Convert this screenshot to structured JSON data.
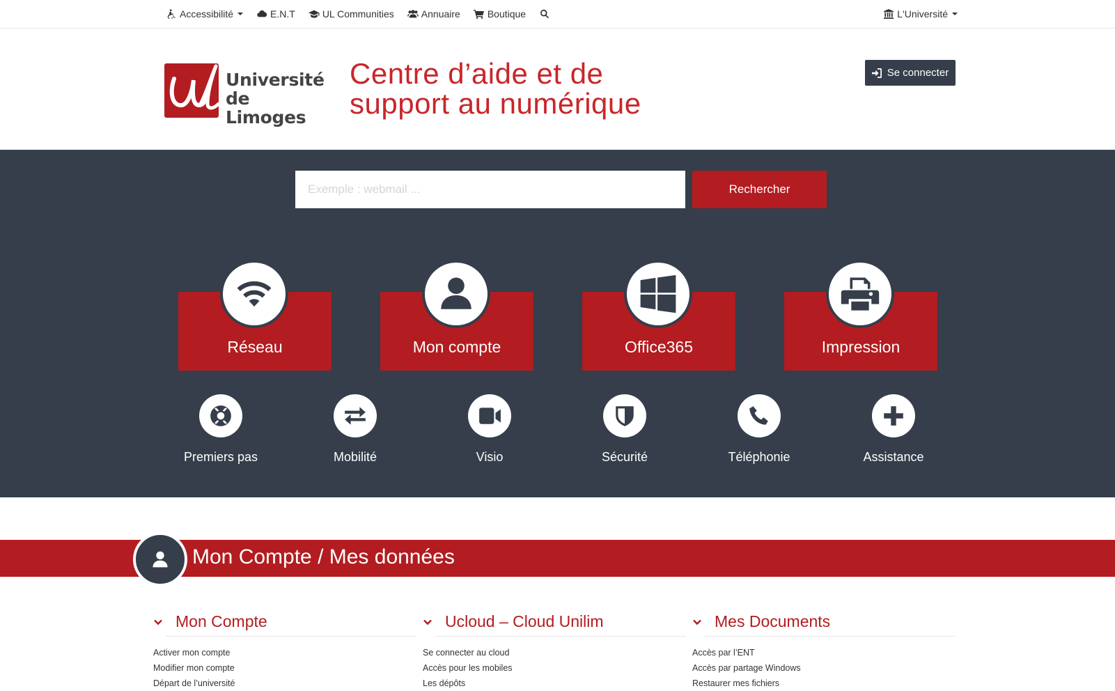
{
  "topbar": {
    "left": [
      {
        "label": "Accessibilité",
        "icon": "wheelchair-icon",
        "caret": true
      },
      {
        "label": "E.N.T",
        "icon": "cloud-icon",
        "caret": false
      },
      {
        "label": "UL Communities",
        "icon": "graduation-cap-icon",
        "caret": false
      },
      {
        "label": "Annuaire",
        "icon": "users-icon",
        "caret": false
      },
      {
        "label": "Boutique",
        "icon": "cart-icon",
        "caret": false
      }
    ],
    "right": {
      "label": "L'Université",
      "icon": "university-icon"
    }
  },
  "header": {
    "logo_line1": "Université",
    "logo_line2": "de Limoges",
    "title_line1": "Centre d’aide et de",
    "title_line2": "support au numérique",
    "login_label": "Se connecter"
  },
  "search": {
    "placeholder": "Exemple : webmail ...",
    "button_label": "Rechercher"
  },
  "big_tiles": [
    {
      "label": "Réseau",
      "icon": "wifi-icon"
    },
    {
      "label": "Mon compte",
      "icon": "user-icon"
    },
    {
      "label": "Office365",
      "icon": "windows-icon"
    },
    {
      "label": "Impression",
      "icon": "printer-icon"
    }
  ],
  "small_tiles": [
    {
      "label": "Premiers pas",
      "icon": "lifebuoy-icon"
    },
    {
      "label": "Mobilité",
      "icon": "exchange-icon"
    },
    {
      "label": "Visio",
      "icon": "video-camera-icon"
    },
    {
      "label": "Sécurité",
      "icon": "shield-icon"
    },
    {
      "label": "Téléphonie",
      "icon": "phone-icon"
    },
    {
      "label": "Assistance",
      "icon": "plus-icon"
    }
  ],
  "section": {
    "title": "Mon Compte / Mes données",
    "icon": "user-icon"
  },
  "columns": [
    {
      "title": "Mon Compte",
      "links": [
        "Activer mon compte",
        "Modifier mon compte",
        "Départ de l’université"
      ]
    },
    {
      "title": "Ucloud – Cloud Unilim",
      "links": [
        "Se connecter au cloud",
        "Accès pour les mobiles",
        "Les dépôts"
      ]
    },
    {
      "title": "Mes Documents",
      "links": [
        "Accès par l’ENT",
        "Accès par partage Windows",
        "Restaurer mes fichiers"
      ]
    }
  ],
  "colors": {
    "brand_red": "#b31c20",
    "dark_slate": "#353e4a"
  }
}
